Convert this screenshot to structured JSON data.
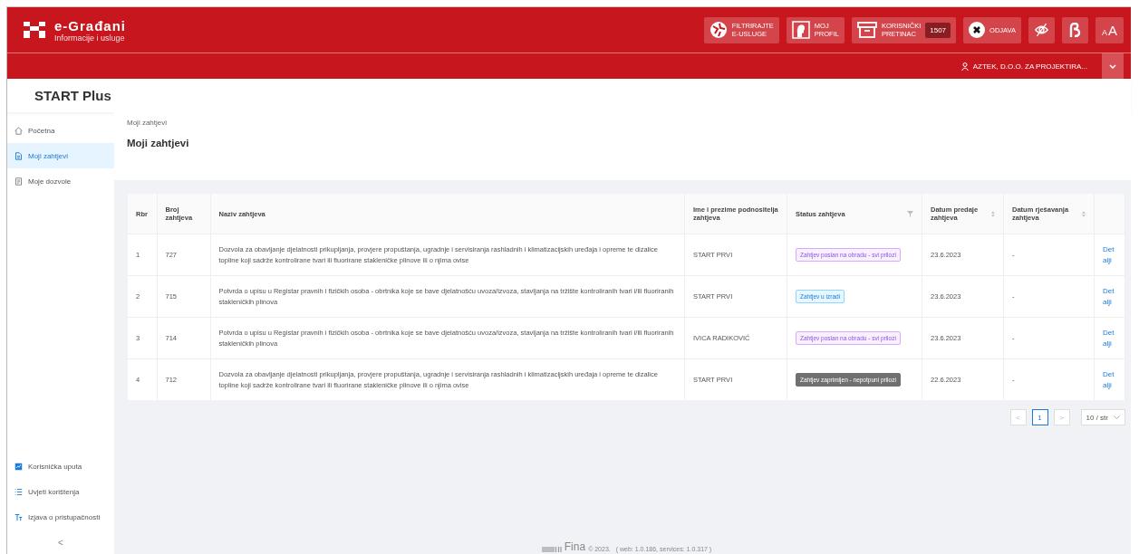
{
  "header": {
    "logo_title": "e-Građani",
    "logo_subtitle": "Informacije i usluge",
    "buttons": [
      {
        "kind": "filter",
        "lines": [
          "FILTRIRAJTE",
          "E-USLUGE"
        ]
      },
      {
        "kind": "profile",
        "lines": [
          "MOJ",
          "PROFIL"
        ]
      },
      {
        "kind": "inbox",
        "lines": [
          "KORISNIČKI",
          "PRETINAC"
        ],
        "count": "1507"
      },
      {
        "kind": "logout",
        "lines": [
          "ODJAVA"
        ]
      },
      {
        "kind": "eye"
      },
      {
        "kind": "font"
      },
      {
        "kind": "textsize",
        "lines": [
          "A",
          "A"
        ]
      }
    ],
    "user": "AZTEK, D.O.O. ZA PROJEKTIRA..."
  },
  "app_title": "START Plus",
  "sidebar": {
    "items": [
      {
        "kind": "home",
        "label": "Početna",
        "selected": false
      },
      {
        "kind": "doc",
        "label": "Moji zahtjevi",
        "selected": true
      },
      {
        "kind": "permit",
        "label": "Moje dozvole",
        "selected": false
      }
    ],
    "footer_items": [
      {
        "kind": "guide",
        "label": "Korisnička uputa"
      },
      {
        "kind": "list",
        "label": "Uvjeti korištenja"
      },
      {
        "kind": "text",
        "label": "Izjava o pristupačnosti"
      }
    ],
    "collapse": "<"
  },
  "breadcrumb": "Moji zahtjevi",
  "page_title": "Moji zahtjevi",
  "table": {
    "columns": [
      {
        "label": "Rbr",
        "kind": "plain"
      },
      {
        "label": "Broj zahtjeva",
        "kind": "plain"
      },
      {
        "label": "Naziv zahtjeva",
        "kind": "plain"
      },
      {
        "label": "Ime i prezime podnositelja zahtjeva",
        "kind": "plain"
      },
      {
        "label": "Status zahtjeva",
        "kind": "filterable"
      },
      {
        "label": "Datum predaje zahtjeva",
        "kind": "sortable"
      },
      {
        "label": "Datum rješavanja zahtjeva",
        "kind": "sortable"
      }
    ],
    "rows": [
      {
        "rbr": "1",
        "number": "727",
        "name": "Dozvola za obavljanje djelatnosti prikupljanja, provjere propuštanja, ugradnje i servisiranja rashladnih i klimatizacijskih uređaja i opreme te dizalice topline koji sadrže kontrolirane tvari ili fluorirane stakleničke plinove ili o njima ovise",
        "applicant": "START PRVI",
        "status": {
          "kind": "sent",
          "label": "Zahtjev poslan na obradu - svi prilozi"
        },
        "submitted": "23.6.2023",
        "resolved": "-",
        "action": "Detalji"
      },
      {
        "rbr": "2",
        "number": "715",
        "name": "Potvrda o upisu u Registar pravnih i fizičkih osoba - obrtnika koje se bave djelatnošću uvoza/izvoza, stavljanja na tržište kontroliranih tvari i/ili fluoriranih stakleničkih plinova",
        "applicant": "START PRVI",
        "status": {
          "kind": "draft",
          "label": "Zahtjev u izradi"
        },
        "submitted": "23.6.2023",
        "resolved": "-",
        "action": "Detalji"
      },
      {
        "rbr": "3",
        "number": "714",
        "name": "Potvrda o upisu u Registar pravnih i fizičkih osoba - obrtnika koje se bave djelatnošću uvoza/izvoza, stavljanja na tržište kontroliranih tvari i/ili fluoriranih stakleničkih plinova",
        "applicant": "IVICA RADIKOVIĆ",
        "status": {
          "kind": "sent",
          "label": "Zahtjev poslan na obradu - svi prilozi"
        },
        "submitted": "23.6.2023",
        "resolved": "-",
        "action": "Detalji"
      },
      {
        "rbr": "4",
        "number": "712",
        "name": "Dozvola za obavljanje djelatnosti prikupljanja, provjere propuštanja, ugradnje i servisiranja rashladnih i klimatizacijskih uređaja i opreme te dizalice topline koji sadrže kontrolirane tvari ili fluorirane stakleničke plinove ili o njima ovise",
        "applicant": "START PRVI",
        "status": {
          "kind": "received",
          "label": "Zahtjev zaprimljen - nepotpuni prilozi"
        },
        "submitted": "22.6.2023",
        "resolved": "-",
        "action": "Detalji"
      }
    ]
  },
  "pagination": {
    "prev": "<",
    "pages": [
      {
        "label": "1",
        "selected": true
      }
    ],
    "next": ">",
    "page_size": "10 / str"
  },
  "footer": {
    "logo": "Fina",
    "copyright": "© 2023.",
    "version": "( web: 1.0.186, services: 1.0.317 )"
  }
}
